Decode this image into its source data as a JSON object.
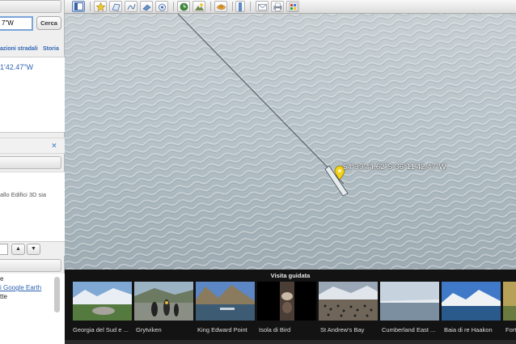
{
  "search": {
    "value": "7\"W",
    "button_label": "Cerca"
  },
  "tabs": {
    "directions": "azioni stradali",
    "history": "Storia"
  },
  "result": {
    "coords": "1'42.47\"W"
  },
  "layers_panel": {
    "text": "allo Edifici 3D sia"
  },
  "nav": {
    "up": "▲",
    "down": "▼"
  },
  "list": {
    "items": [
      "e",
      "i Google Earth",
      "tte"
    ]
  },
  "close_label": "×",
  "map": {
    "placemark_label": "54°39'44.62\"S 36°11'42.47\"W",
    "pin_color": "#f2d21b"
  },
  "tour": {
    "title": "Visita guidata",
    "items": [
      {
        "label": "Georgia del Sud e ..."
      },
      {
        "label": "Grytviken"
      },
      {
        "label": "King Edward Point"
      },
      {
        "label": "Isola di Bird"
      },
      {
        "label": "St Andrew's Bay"
      },
      {
        "label": "Cumberland East ..."
      },
      {
        "label": "Baia di re Haakon"
      },
      {
        "label": "Fort"
      }
    ]
  },
  "toolbar": {
    "icons": [
      "sidebar-toggle-icon",
      "placemark-icon",
      "polygon-icon",
      "path-icon",
      "image-overlay-icon",
      "record-tour-icon",
      "historical-imagery-icon",
      "sun-icon",
      "planets-icon",
      "ruler-icon",
      "email-icon",
      "print-icon",
      "maps-icon"
    ]
  }
}
